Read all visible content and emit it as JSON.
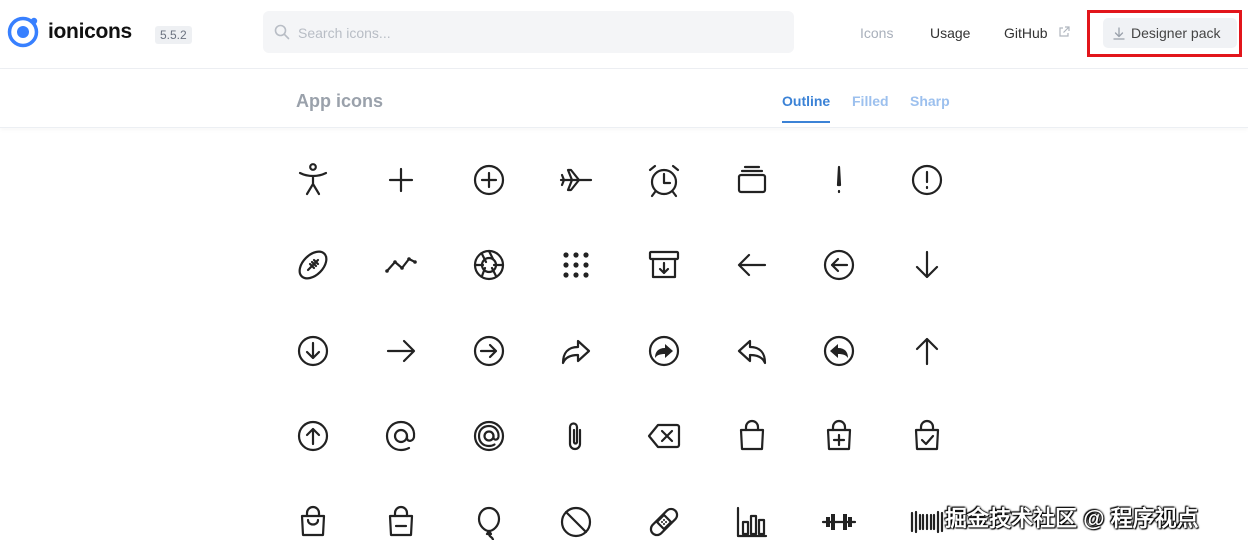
{
  "header": {
    "brand": "ionicons",
    "version": "5.5.2",
    "search": {
      "placeholder": "Search icons...",
      "value": ""
    },
    "nav": {
      "icons": "Icons",
      "usage": "Usage",
      "github": "GitHub",
      "designer_pack": "Designer pack"
    }
  },
  "section": {
    "title": "App icons",
    "tabs": [
      "Outline",
      "Filled",
      "Sharp"
    ],
    "active_tab": "Outline"
  },
  "icons": [
    "accessibility-icon",
    "add-icon",
    "add-circle-icon",
    "airplane-icon",
    "alarm-icon",
    "albums-icon",
    "alert-icon",
    "alert-circle-icon",
    "american-football-icon",
    "analytics-icon",
    "aperture-icon",
    "apps-icon",
    "archive-icon",
    "arrow-back-icon",
    "arrow-back-circle-icon",
    "arrow-down-icon",
    "arrow-down-circle-icon",
    "arrow-forward-icon",
    "arrow-forward-circle-icon",
    "arrow-redo-icon",
    "arrow-redo-circle-icon",
    "arrow-undo-icon",
    "arrow-undo-circle-icon",
    "arrow-up-icon",
    "arrow-up-circle-icon",
    "at-icon",
    "at-circle-icon",
    "attach-icon",
    "backspace-icon",
    "bag-icon",
    "bag-add-icon",
    "bag-check-icon",
    "bag-handle-icon",
    "bag-remove-icon",
    "balloon-icon",
    "ban-icon",
    "bandage-icon",
    "bar-chart-icon",
    "barbell-icon",
    "barcode-icon"
  ],
  "watermark": "掘金技术社区 @ 程序视点",
  "colors": {
    "accent": "#3b82d6",
    "highlight": "#e2151b",
    "icon": "#222222"
  }
}
